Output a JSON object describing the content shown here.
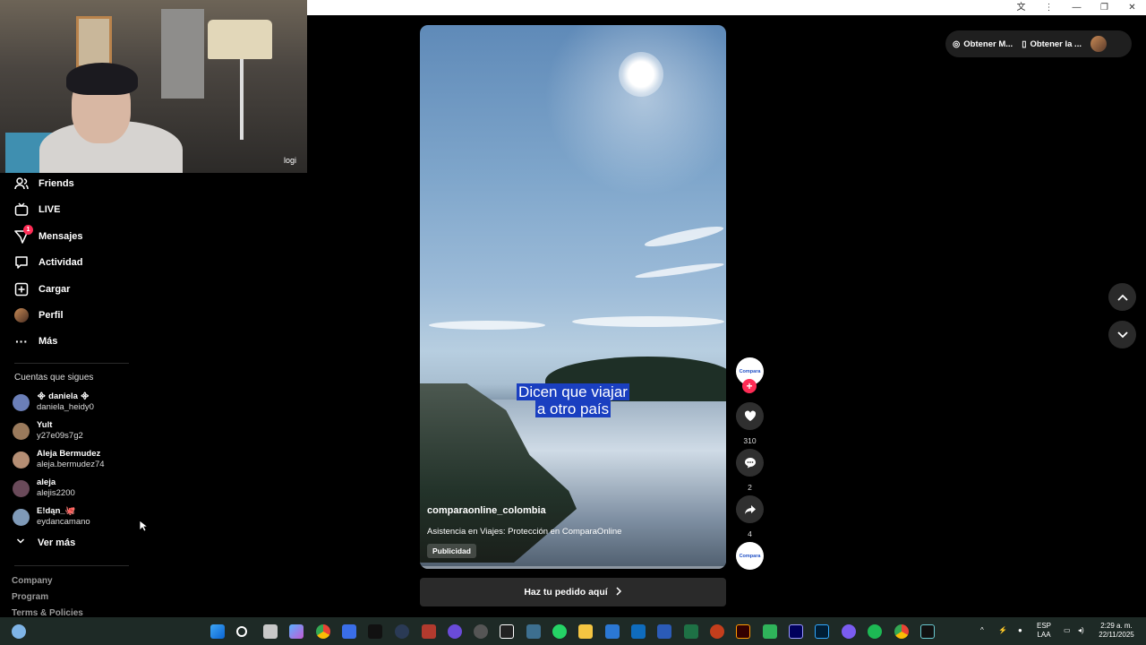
{
  "webcam": {
    "overlay_tag": "logi"
  },
  "sidebar": {
    "items": [
      {
        "label": "Friends",
        "icon": "friends-icon"
      },
      {
        "label": "LIVE",
        "icon": "live-icon"
      },
      {
        "label": "Mensajes",
        "icon": "messages-icon",
        "badge": "1"
      },
      {
        "label": "Actividad",
        "icon": "activity-icon"
      },
      {
        "label": "Cargar",
        "icon": "upload-icon"
      },
      {
        "label": "Perfil",
        "icon": "profile-avatar"
      },
      {
        "label": "Más",
        "icon": "more-icon"
      }
    ],
    "following_title": "Cuentas que sigues",
    "accounts": [
      {
        "name": "᯽ daniela ᯽",
        "handle": "daniela_heidy0",
        "color": "#6b7fb8"
      },
      {
        "name": "Yult",
        "handle": "y27e09s7g2",
        "color": "#9a7a5c"
      },
      {
        "name": "Aleja Bermudez",
        "handle": "aleja.bermudez74",
        "color": "#b58e74"
      },
      {
        "name": "aleja",
        "handle": "alejis2200",
        "color": "#6a4a5a"
      },
      {
        "name": "E!dąn_🐙",
        "handle": "eydancamano",
        "color": "#7f9ab8"
      }
    ],
    "see_more": "Ver más",
    "footer": [
      "Company",
      "Program",
      "Terms & Policies"
    ]
  },
  "video": {
    "caption_line1": "Dicen que viajar",
    "caption_line2": "a otro país",
    "author": "comparaonline_colombia",
    "description": "Asistencia en Viajes: Protección en ComparaOnline",
    "tag": "Publicidad",
    "cta": "Haz tu pedido aquí"
  },
  "actions": {
    "creator_label": "Compara",
    "likes": "310",
    "comments": "2",
    "shares": "4"
  },
  "topright": {
    "get_mobile": "Obtener M...",
    "get_app": "Obtener la ..."
  },
  "taskbar": {
    "language": "ESP",
    "layout": "LAA",
    "time": "2:29 a. m.",
    "date": "22/11/2025"
  },
  "colors": {
    "accent": "#fe2c55",
    "caption_bg": "#1a3fc0"
  }
}
